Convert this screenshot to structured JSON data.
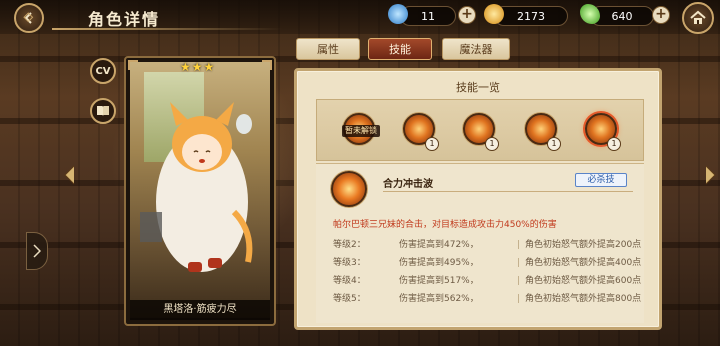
{
  "header": {
    "title": "角色详情",
    "resources": [
      {
        "name": "blue-crystal",
        "value": "11",
        "color": "#4aa8e8"
      },
      {
        "name": "gold-coin",
        "value": "2173",
        "color": "#f2b430"
      },
      {
        "name": "green-leaf-gem",
        "value": "640",
        "color": "#5ecb3a"
      }
    ],
    "plus_label": "+"
  },
  "side": {
    "cv_label": "CV"
  },
  "card": {
    "stars": "★★★",
    "caption": "黑塔洛·筋疲力尽",
    "star_count": 3
  },
  "tabs": [
    {
      "label": "属性",
      "active": false
    },
    {
      "label": "技能",
      "active": true
    },
    {
      "label": "魔法器",
      "active": false
    }
  ],
  "skills_panel": {
    "heading": "技能一览",
    "locked_label": "暂未解锁",
    "skill_levels": [
      "1",
      "1",
      "1",
      "1"
    ],
    "selected": {
      "name": "合力冲击波",
      "tag": "必杀技",
      "description": "帕尔巴顿三兄妹的合击，对目标造成攻击力450%的伤害",
      "levels": [
        {
          "level": "等级2：",
          "effect": "伤害提高到472%，",
          "sep": "|",
          "bonus": "角色初始怒气额外提高200点"
        },
        {
          "level": "等级3：",
          "effect": "伤害提高到495%，",
          "sep": "|",
          "bonus": "角色初始怒气额外提高400点"
        },
        {
          "level": "等级4：",
          "effect": "伤害提高到517%，",
          "sep": "|",
          "bonus": "角色初始怒气额外提高600点"
        },
        {
          "level": "等级5：",
          "effect": "伤害提高到562%，",
          "sep": "|",
          "bonus": "角色初始怒气额外提高800点"
        }
      ]
    }
  }
}
